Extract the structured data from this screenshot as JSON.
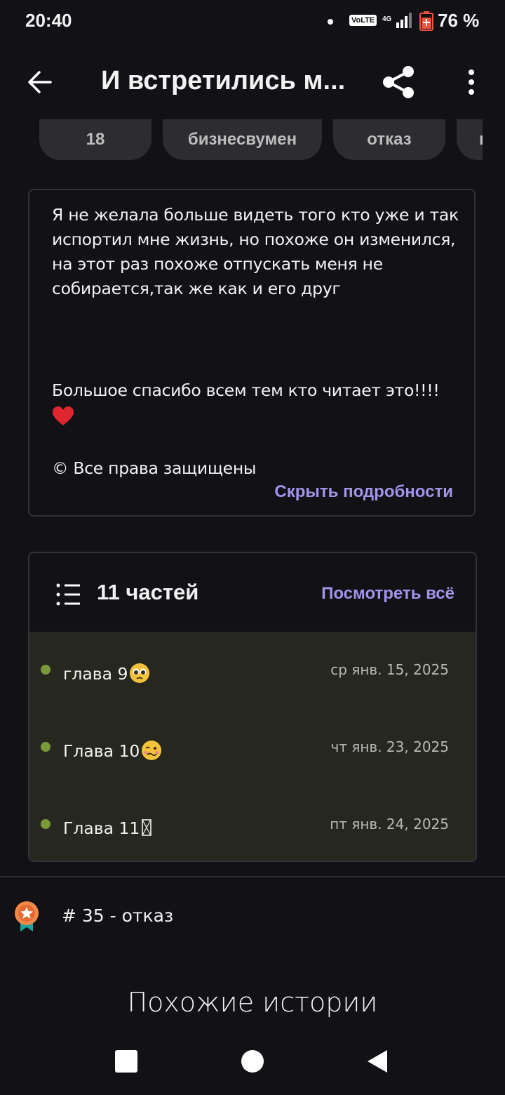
{
  "status_bar": {
    "time": "20:40",
    "volte": "VoLTE",
    "network": "4G",
    "battery_percent": "76 %"
  },
  "top_bar": {
    "title": "И встретились м..."
  },
  "tags": [
    {
      "label": "18"
    },
    {
      "label": "бизнесвумен"
    },
    {
      "label": "отказ"
    },
    {
      "label": "г"
    }
  ],
  "description": {
    "text": "Я не желала больше видеть того кто уже и так испортил мне жизнь, но похоже он изменился, на этот раз похоже отпускать меня не собирается,так же как и его друг",
    "thanks": "Большое спасибо всем тем кто читает это!!!!",
    "copyright": "© Все права защищены",
    "hide_label": "Скрыть подробности"
  },
  "parts": {
    "count_label": "11 частей",
    "view_all_label": "Посмотреть всё",
    "items": [
      {
        "title": "глава 9",
        "date": "ср янв. 15, 2025",
        "emoji": "pleading-face-icon"
      },
      {
        "title": "Глава 10",
        "date": "чт янв. 23, 2025",
        "emoji": "woozy-face-icon"
      },
      {
        "title": "Глава 11",
        "date": "пт янв. 24, 2025",
        "emoji": "missing-glyph-icon"
      }
    ]
  },
  "ranking": {
    "text": "# 35 - отказ"
  },
  "similar": {
    "heading": "Похожие истории"
  },
  "colors": {
    "background": "#121116",
    "accent": "#a393ea",
    "list_bg": "#26271f",
    "dot": "#7a9a3a"
  }
}
